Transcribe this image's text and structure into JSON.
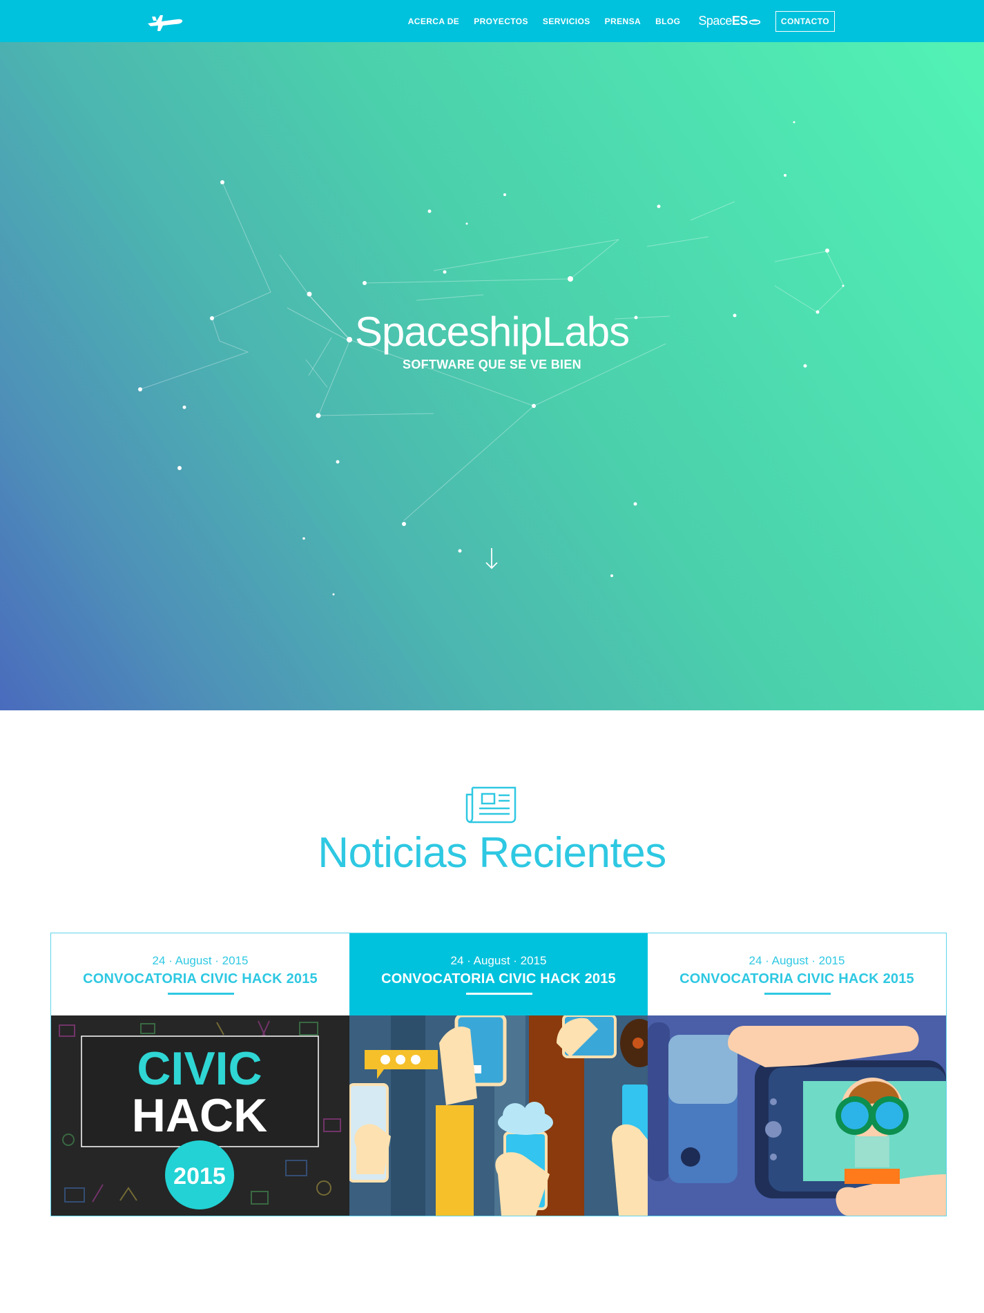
{
  "nav": {
    "items": [
      {
        "label": "ACERCA DE"
      },
      {
        "label": "PROYECTOS"
      },
      {
        "label": "SERVICIOS"
      },
      {
        "label": "PRENSA"
      },
      {
        "label": "BLOG"
      }
    ],
    "spacees": {
      "prefix": "Space",
      "suffix": "ES"
    },
    "contact_label": "CONTACTO"
  },
  "hero": {
    "title": "SpaceshipLabs",
    "subtitle": "SOFTWARE QUE SE VE BIEN"
  },
  "news": {
    "title": "Noticias Recientes",
    "cards": [
      {
        "date": "24 · August · 2015",
        "title": "CONVOCATORIA CIVIC HACK 2015",
        "image_text": [
          "CIVIC",
          "HACK",
          "2015"
        ]
      },
      {
        "date": "24 · August · 2015",
        "title": "CONVOCATORIA CIVIC HACK 2015"
      },
      {
        "date": "24 · August · 2015",
        "title": "CONVOCATORIA CIVIC HACK 2015"
      }
    ]
  },
  "colors": {
    "brand": "#00c2dd",
    "accent_text": "#2ec8e2",
    "hero_gradient_start": "#4a6bbd",
    "hero_gradient_end": "#52f3b5"
  },
  "icons": [
    "spaceship-logo-icon",
    "arrow-down-icon",
    "newspaper-icon"
  ]
}
